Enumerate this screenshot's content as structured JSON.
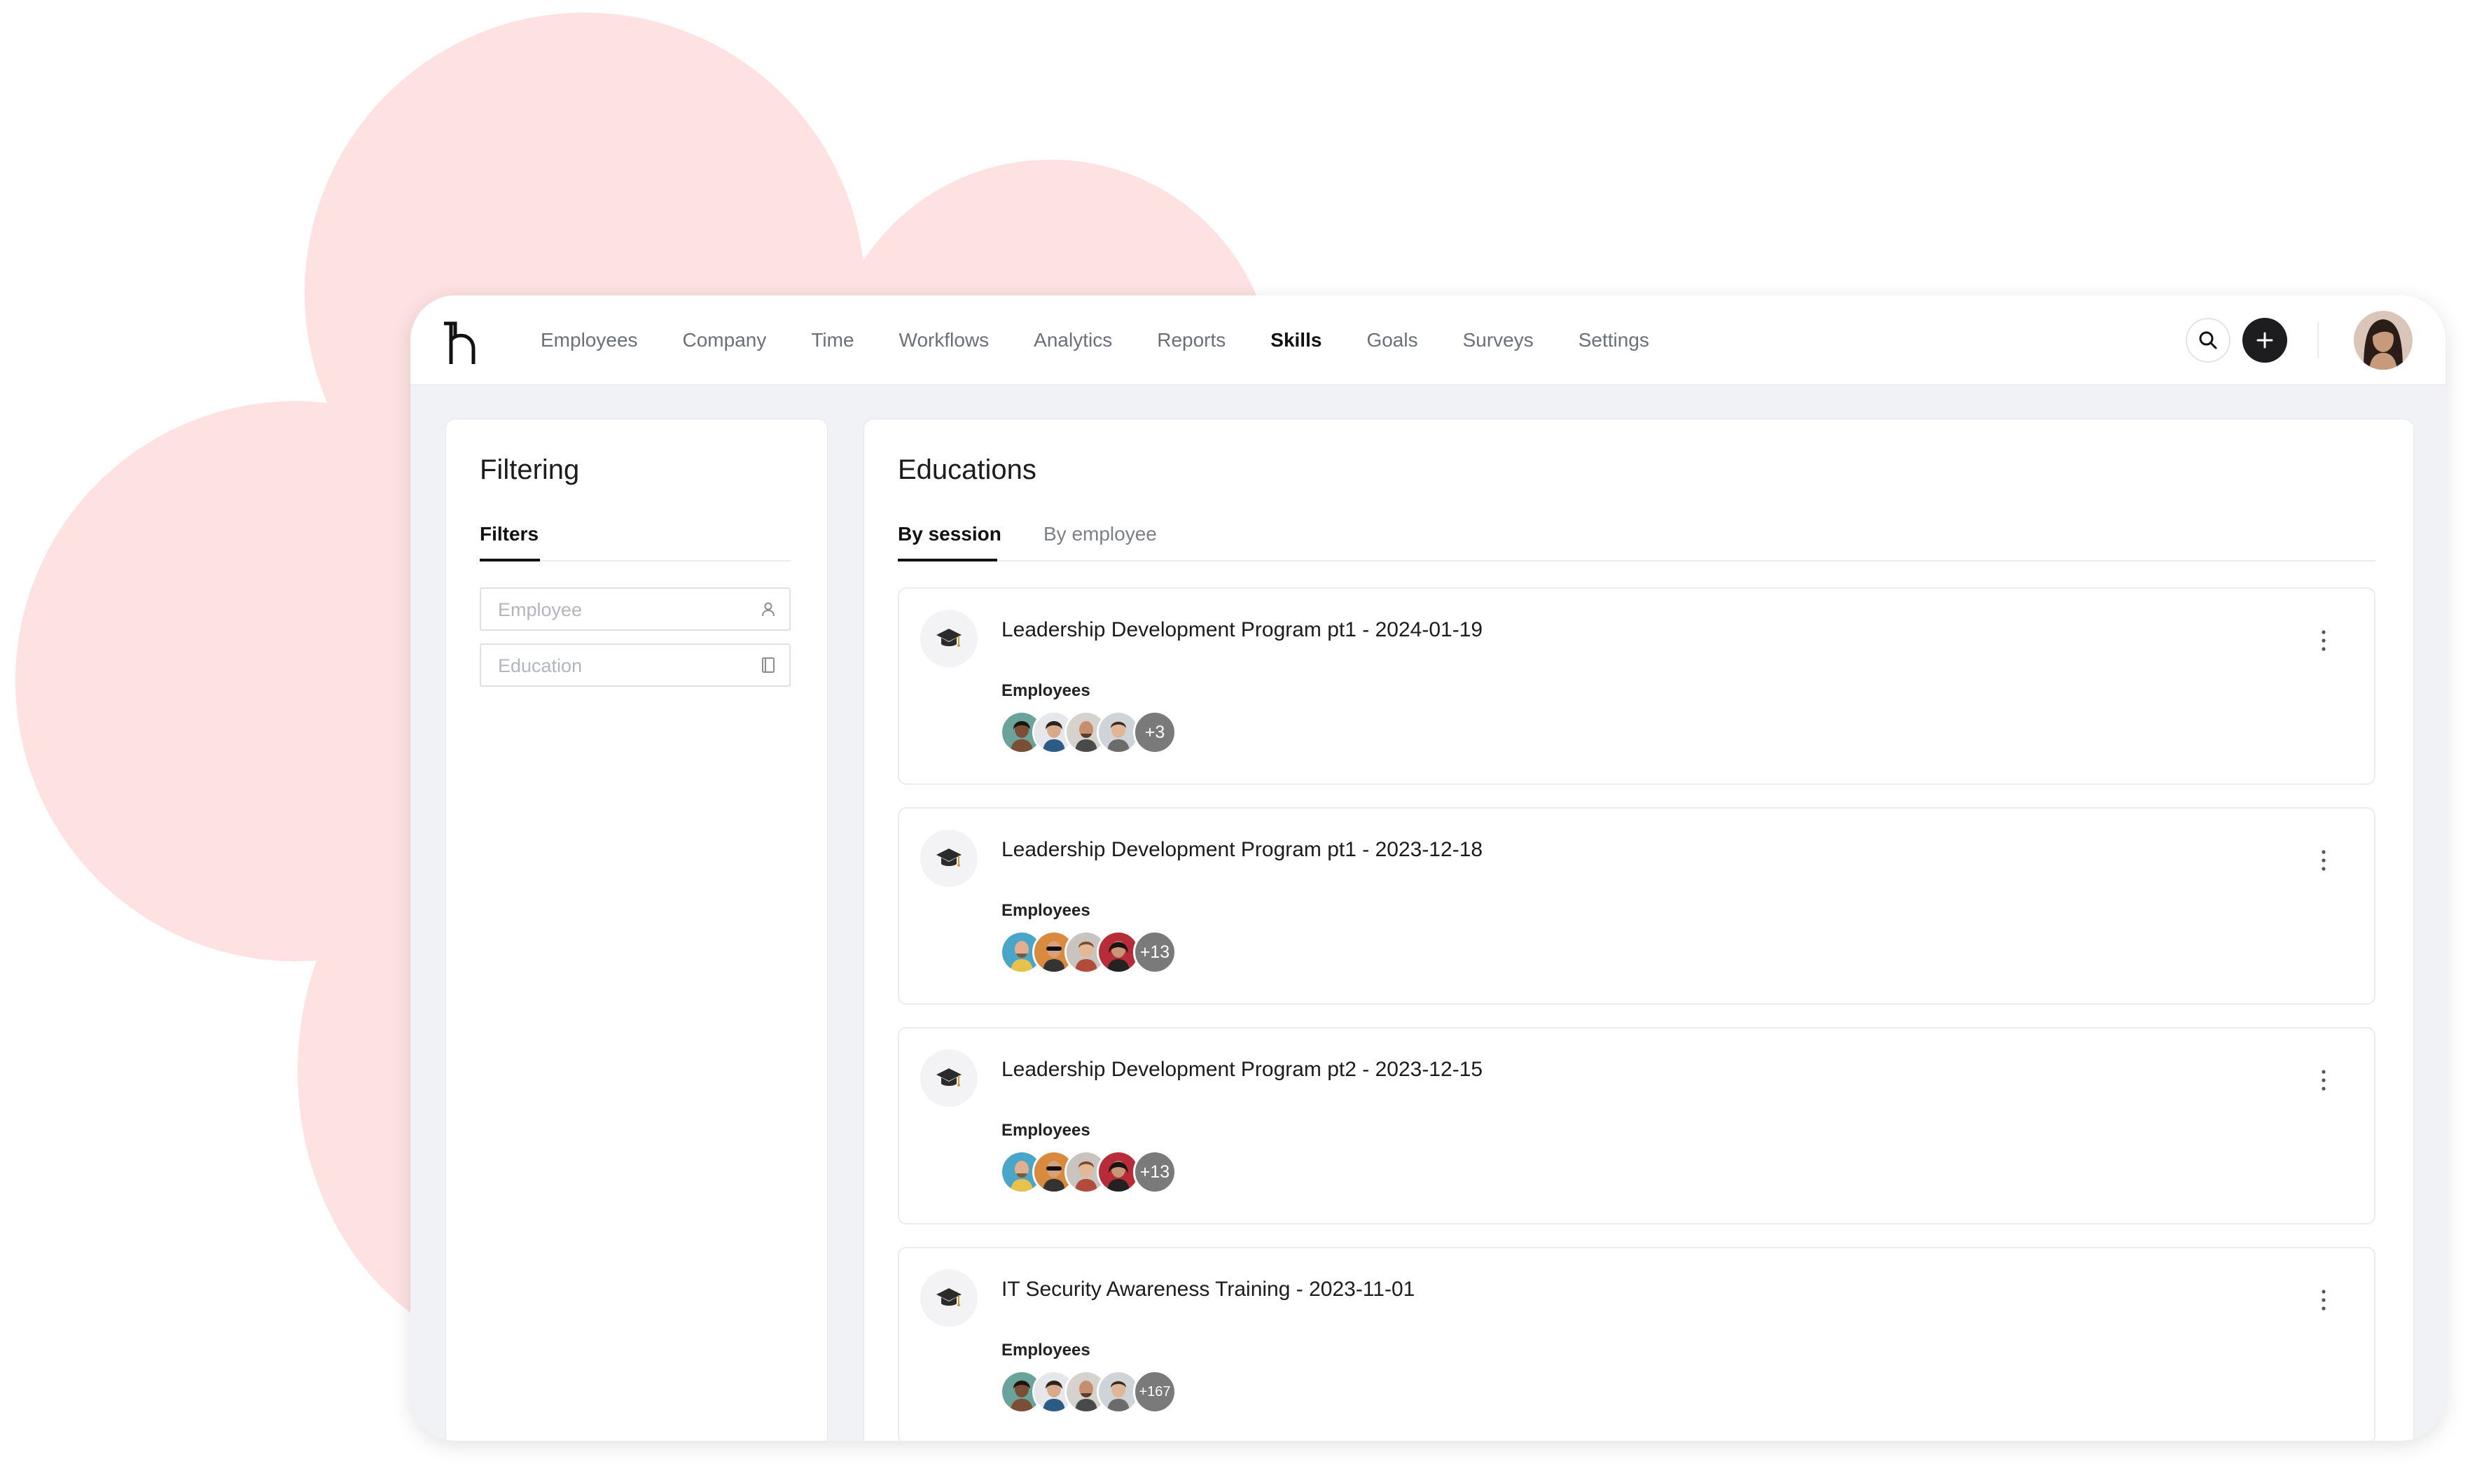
{
  "nav": {
    "items": [
      {
        "label": "Employees"
      },
      {
        "label": "Company"
      },
      {
        "label": "Time"
      },
      {
        "label": "Workflows"
      },
      {
        "label": "Analytics"
      },
      {
        "label": "Reports"
      },
      {
        "label": "Skills",
        "active": true
      },
      {
        "label": "Goals"
      },
      {
        "label": "Surveys"
      },
      {
        "label": "Settings"
      }
    ],
    "search_icon": "search-icon",
    "add_icon": "plus-icon"
  },
  "filtering": {
    "title": "Filtering",
    "tab": "Filters",
    "employee_placeholder": "Employee",
    "education_placeholder": "Education"
  },
  "main": {
    "title": "Educations",
    "tabs": [
      {
        "label": "By session",
        "active": true
      },
      {
        "label": "By employee",
        "active": false
      }
    ]
  },
  "sessions": [
    {
      "title": "Leadership Development Program pt1 - 2024-01-19",
      "employees_label": "Employees",
      "more": "+3"
    },
    {
      "title": "Leadership Development Program pt1 - 2023-12-18",
      "employees_label": "Employees",
      "more": "+13"
    },
    {
      "title": "Leadership Development Program pt2 - 2023-12-15",
      "employees_label": "Employees",
      "more": "+13"
    },
    {
      "title": "IT Security Awareness Training - 2023-11-01",
      "employees_label": "Employees",
      "more": "+167"
    }
  ],
  "colors": {
    "background_blob": "#fde2e1",
    "accent": "#111111",
    "avatar_more": "#7a7a7a"
  }
}
